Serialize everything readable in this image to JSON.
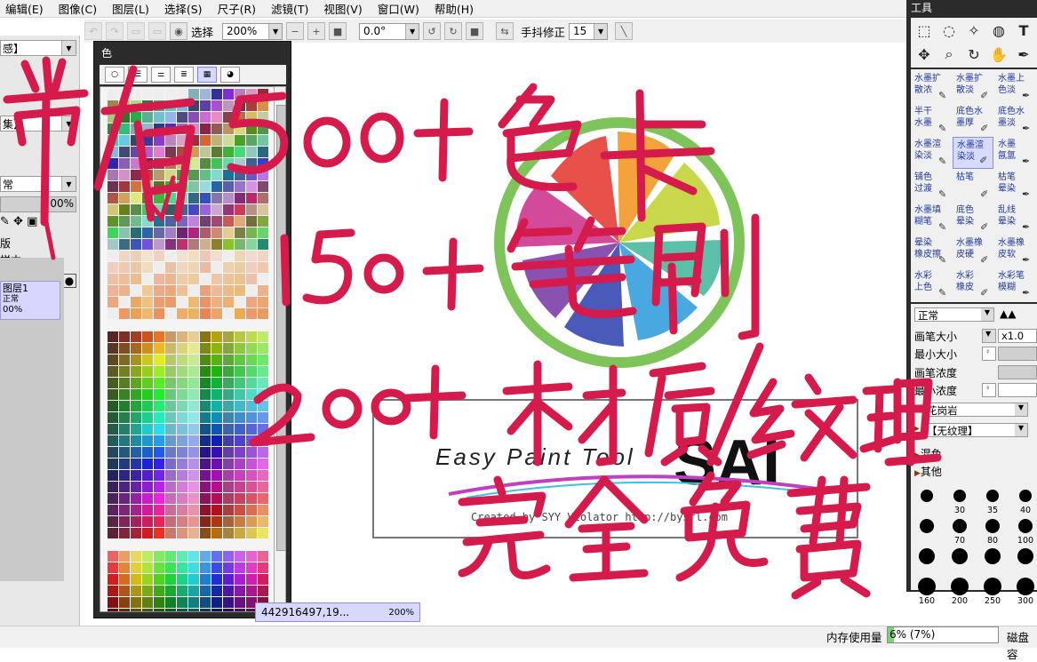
{
  "menubar": {
    "items": [
      "编辑(E)",
      "图像(C)",
      "图层(L)",
      "选择(S)",
      "尺子(R)",
      "滤镜(T)",
      "视图(V)",
      "窗口(W)",
      "帮助(H)"
    ]
  },
  "toolbar": {
    "select_label": "选择",
    "zoom": "200%",
    "rotation": "0.0°",
    "stabilizer_label": "手抖修正",
    "stabilizer_value": "15"
  },
  "left_panel": {
    "combo1": "感】",
    "combo2": "集】",
    "blend_mode": "常",
    "opacity": "00%",
    "text_a": "版",
    "text_b": "样本",
    "layer_name": "图层1",
    "layer_mode": "正常",
    "layer_opacity": "00%"
  },
  "color_window": {
    "title": "色",
    "tab_icons": [
      "circle-icon",
      "bars-icon",
      "sliders-icon",
      "list-icon",
      "grid-icon",
      "palette-icon"
    ],
    "active_tab": 4
  },
  "canvas": {
    "logo_subtitle": "Easy Paint Tool",
    "logo_title": "SAI",
    "credit_text": "Created by SYY Violator  http://bysfl.com",
    "colors": {
      "ring_green": "#7fc45a",
      "wedge_red": "#e8504a",
      "wedge_orange": "#f3a23c",
      "wedge_yellow": "#c8d84a",
      "wedge_teal": "#5cc0a8",
      "wedge_blue": "#4aa8e0",
      "wedge_indigo": "#4a5ab8",
      "wedge_purple": "#8a52b0",
      "wedge_magenta": "#d44a9a"
    }
  },
  "status": {
    "nav_text": "442916497,19...",
    "nav_zoom": "200%",
    "memory_label": "内存使用量",
    "memory_value": "6% (7%)",
    "memory_fraction": 0.06,
    "disk_label": "磁盘容"
  },
  "tool_panel": {
    "title": "工具",
    "tools": [
      "marquee-icon",
      "lasso-icon",
      "magic-wand-icon",
      "fill-icon",
      "text-icon",
      "move-icon",
      "zoom-icon",
      "rotate-icon",
      "hand-icon",
      "eyedropper-icon"
    ],
    "brushes": [
      [
        "水墨扩",
        "散浓"
      ],
      [
        "水墨扩",
        "散淡"
      ],
      [
        "水墨上",
        "色淡"
      ],
      [
        "半干",
        "水墨"
      ],
      [
        "底色水",
        "墨厚"
      ],
      [
        "底色水",
        "墨淡"
      ],
      [
        "水墨渲",
        "染淡"
      ],
      [
        "水墨渲",
        "染淡"
      ],
      [
        "水墨",
        "氤氲"
      ],
      [
        "铺色",
        "过渡"
      ],
      [
        "枯笔",
        ""
      ],
      [
        "枯笔",
        "晕染"
      ],
      [
        "水墨填",
        "糊笔"
      ],
      [
        "底色",
        "晕染"
      ],
      [
        "乱线",
        "晕染"
      ],
      [
        "晕染",
        "橡皮擦"
      ],
      [
        "水墨橡",
        "皮硬"
      ],
      [
        "水墨橡",
        "皮软"
      ],
      [
        "水彩",
        "上色"
      ],
      [
        "水彩",
        "橡皮"
      ],
      [
        "水彩笔",
        "模糊"
      ]
    ],
    "active_brush": 7,
    "blend_mode": "正常",
    "size_label": "画笔大小",
    "size_multiplier": "x1.0",
    "min_size_label": "最小大小",
    "density_label": "画笔浓度",
    "min_density_label": "最小浓度",
    "paper_texture": "花岗岩",
    "texture": "【无纹理】",
    "mix_label": "混色",
    "other_label": "其他",
    "dot_sizes": [
      "",
      "",
      "",
      "",
      "",
      "",
      "",
      "",
      "",
      "",
      "",
      "",
      "",
      "",
      "",
      ""
    ],
    "dot_labels": [
      "",
      "30",
      "35",
      "40",
      "",
      "70",
      "80",
      "100",
      "",
      "",
      "",
      "",
      "160",
      "200",
      "250",
      "300"
    ]
  },
  "overlay": {
    "line1": "带有500+色卡",
    "line2": "150+笔刷",
    "line3": "200+材质/纹理",
    "line4": "完全免费",
    "ink": "#d41b4b"
  }
}
